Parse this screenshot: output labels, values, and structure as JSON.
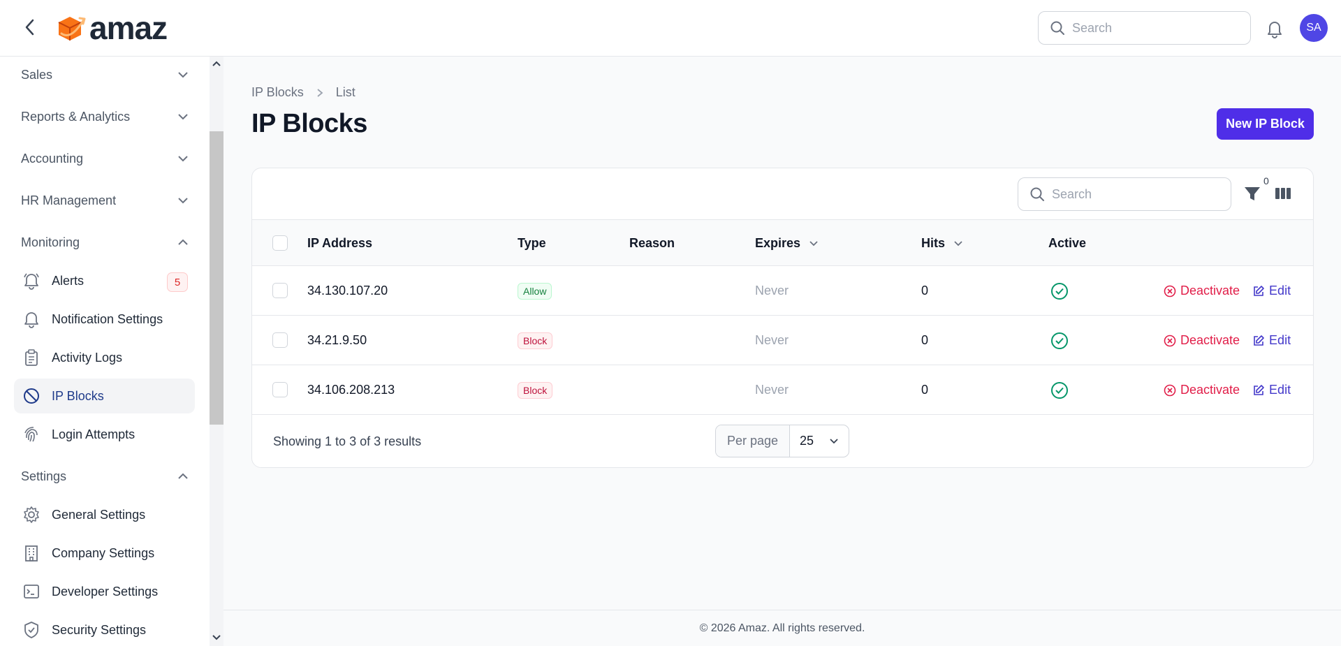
{
  "header": {
    "brand": "amaz",
    "search_placeholder": "Search",
    "avatar_initials": "SA"
  },
  "sidebar": {
    "groups": [
      {
        "label": "Sales",
        "expanded": false
      },
      {
        "label": "Reports & Analytics",
        "expanded": false
      },
      {
        "label": "Accounting",
        "expanded": false
      },
      {
        "label": "HR Management",
        "expanded": false
      },
      {
        "label": "Monitoring",
        "expanded": true
      },
      {
        "label": "Settings",
        "expanded": true
      }
    ],
    "monitoring_items": [
      {
        "label": "Alerts",
        "icon": "bell-icon",
        "badge": "5"
      },
      {
        "label": "Notification Settings",
        "icon": "bell-icon"
      },
      {
        "label": "Activity Logs",
        "icon": "clipboard-icon"
      },
      {
        "label": "IP Blocks",
        "icon": "no-entry-icon",
        "active": true
      },
      {
        "label": "Login Attempts",
        "icon": "fingerprint-icon"
      }
    ],
    "settings_items": [
      {
        "label": "General Settings",
        "icon": "gear-icon"
      },
      {
        "label": "Company Settings",
        "icon": "building-icon"
      },
      {
        "label": "Developer Settings",
        "icon": "terminal-icon"
      },
      {
        "label": "Security Settings",
        "icon": "shield-icon"
      }
    ]
  },
  "breadcrumb": {
    "parent": "IP Blocks",
    "current": "List"
  },
  "page": {
    "title": "IP Blocks",
    "new_button": "New IP Block"
  },
  "table": {
    "search_placeholder": "Search",
    "filter_count": "0",
    "columns": {
      "ip": "IP Address",
      "type": "Type",
      "reason": "Reason",
      "expires": "Expires",
      "hits": "Hits",
      "active": "Active"
    },
    "rows": [
      {
        "ip": "34.130.107.20",
        "type": "Allow",
        "reason": "",
        "expires": "Never",
        "hits": "0",
        "active": true
      },
      {
        "ip": "34.21.9.50",
        "type": "Block",
        "reason": "",
        "expires": "Never",
        "hits": "0",
        "active": true
      },
      {
        "ip": "34.106.208.213",
        "type": "Block",
        "reason": "",
        "expires": "Never",
        "hits": "0",
        "active": true
      }
    ],
    "row_actions": {
      "deactivate": "Deactivate",
      "edit": "Edit"
    },
    "showing": "Showing 1 to 3 of 3 results",
    "per_page_label": "Per page",
    "per_page_value": "25"
  },
  "footer": {
    "copyright": "© 2026 Amaz. All rights reserved."
  },
  "colors": {
    "accent": "#4f2ee8",
    "danger": "#e11d48",
    "success": "#059669"
  }
}
